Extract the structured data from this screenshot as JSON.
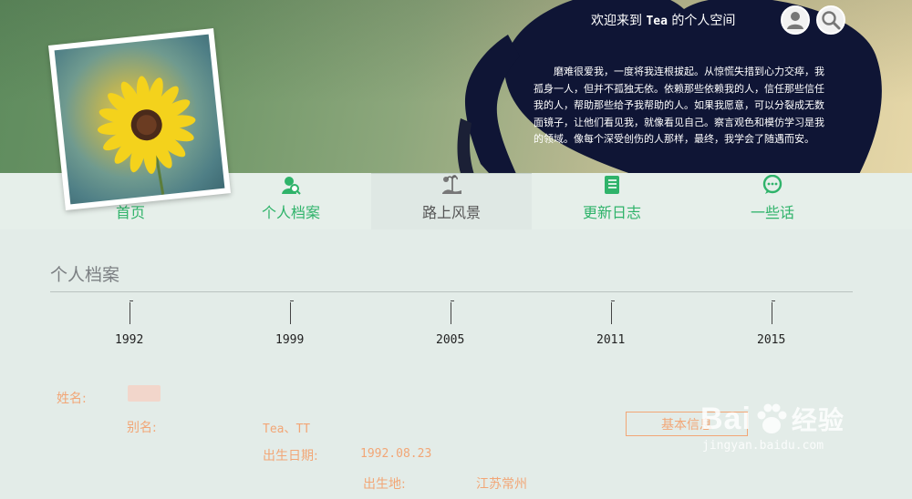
{
  "header": {
    "welcome_prefix": "欢迎来到 ",
    "username": "Tea",
    "welcome_suffix": " 的个人空间",
    "quote": "磨难很爱我，一度将我连根拔起。从惊慌失措到心力交瘁，我孤身一人，但并不孤独无依。依赖那些依赖我的人，信任那些信任我的人，帮助那些给予我帮助的人。如果我愿意，可以分裂成无数面镜子，让他们看见我，就像看见自己。察言观色和模仿学习是我的领域。像每个深受创伤的人那样，最终，我学会了随遇而安。",
    "user_icon": "user-icon",
    "search_icon": "search-icon"
  },
  "nav": {
    "items": [
      {
        "label": "首页",
        "icon": "home-icon"
      },
      {
        "label": "个人档案",
        "icon": "profile-icon"
      },
      {
        "label": "路上风景",
        "icon": "scenery-icon"
      },
      {
        "label": "更新日志",
        "icon": "notebook-icon"
      },
      {
        "label": "一些话",
        "icon": "chat-icon"
      }
    ],
    "active_index": 2
  },
  "profile": {
    "title": "个人档案",
    "years": [
      "1992",
      "1999",
      "2005",
      "2011",
      "2015"
    ],
    "name_label": "姓名:",
    "alias_label": "别名:",
    "alias_value": "Tea、TT",
    "birthday_label": "出生日期:",
    "birthday_value": "1992.08.23",
    "birthplace_label": "出生地:",
    "birthplace_value": "江苏常州",
    "info_button": "基本信息"
  },
  "watermark": {
    "brand": "Bai",
    "brand_cn": "经验",
    "url": "jingyan.baidu.com"
  },
  "colors": {
    "accent_green": "#2fb36a",
    "label_orange": "#f2a676",
    "heart_navy": "#0f1535"
  }
}
